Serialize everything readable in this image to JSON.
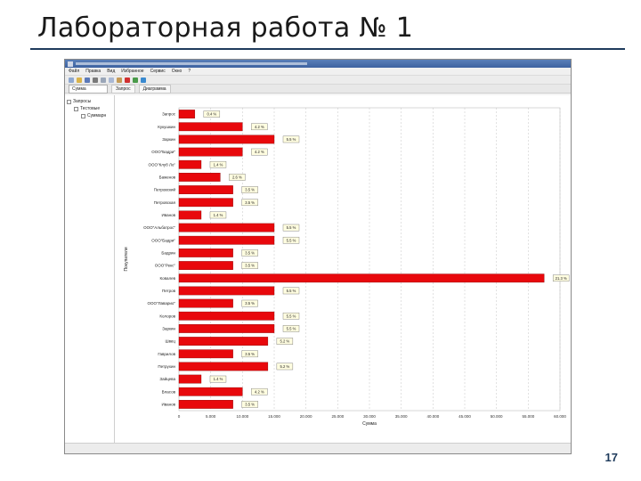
{
  "slide": {
    "title": "Лабораторная работа № 1",
    "page_number": "17"
  },
  "app": {
    "menu": [
      "Файл",
      "Правка",
      "Вид",
      "Избранное",
      "Сервис",
      "Окно",
      "?"
    ],
    "tabs": [
      "Запрос",
      "Диаграмма"
    ],
    "combo_value": "Сумма"
  },
  "tree": {
    "items": [
      "Запросы",
      "Тестовые",
      "Суммарн"
    ]
  },
  "chart_data": {
    "type": "bar",
    "orientation": "horizontal",
    "categories": [
      "Запрос",
      "Кукушкин",
      "Заркин",
      "ООО\"Бадри\"",
      "ООО\"Клуб Ло\"",
      "Баженов",
      "Петровский",
      "Петровская",
      "Иванов",
      "ООО\"Альбатрос\"",
      "ООО\"Бадри\"",
      "Бадрин",
      "ООО\"Рекс\"",
      "Ковалев",
      "Петров",
      "ООО\"Лаварио\"",
      "Колоров",
      "Заркин",
      "Швец",
      "Гаврилов",
      "Петрухин",
      "Зайцева",
      "Власов",
      "Иванов"
    ],
    "values": [
      2.5,
      10,
      15,
      10,
      3.5,
      6.5,
      8.5,
      8.5,
      3.5,
      15,
      15,
      8.5,
      8.5,
      57.5,
      15,
      8.5,
      15,
      15,
      14,
      8.5,
      14,
      3.5,
      10,
      8.5
    ],
    "data_labels": [
      "0.4 %",
      "4.2 %",
      "5.5 %",
      "4.2 %",
      "1.4 %",
      "2.6 %",
      "3.5 %",
      "3.5 %",
      "1.4 %",
      "5.5 %",
      "5.5 %",
      "3.5 %",
      "3.5 %",
      "21.3 %",
      "5.5 %",
      "3.5 %",
      "5.5 %",
      "5.5 %",
      "5.2 %",
      "3.5 %",
      "5.2 %",
      "1.4 %",
      "4.2 %",
      "3.5 %"
    ],
    "xlim": [
      0,
      60
    ],
    "x_ticks": [
      "0",
      "5.000",
      "10.000",
      "15.000",
      "20.000",
      "25.000",
      "30.000",
      "35.000",
      "40.000",
      "45.000",
      "50.000",
      "55.000",
      "60.000"
    ],
    "xlabel": "Сумма",
    "ylabel": "Покупатели",
    "grid": true,
    "bar_color": "#e8080c",
    "label_box_color": "#fffde0"
  }
}
